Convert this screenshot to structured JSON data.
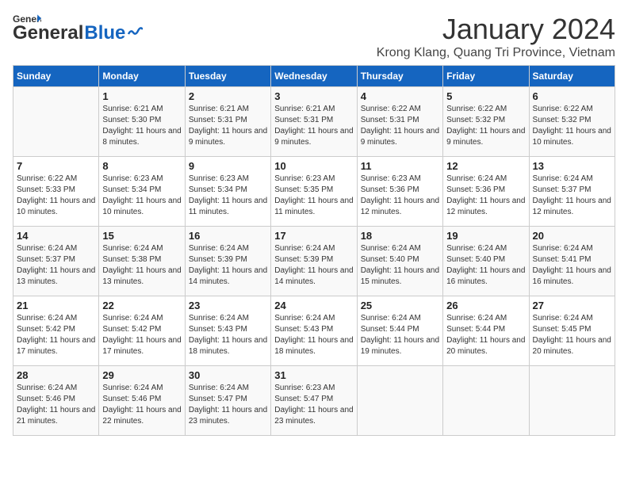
{
  "header": {
    "logo_line1": "General",
    "logo_line2": "Blue",
    "month": "January 2024",
    "location": "Krong Klang, Quang Tri Province, Vietnam"
  },
  "days_of_week": [
    "Sunday",
    "Monday",
    "Tuesday",
    "Wednesday",
    "Thursday",
    "Friday",
    "Saturday"
  ],
  "weeks": [
    [
      {
        "num": "",
        "sunrise": "",
        "sunset": "",
        "daylight": ""
      },
      {
        "num": "1",
        "sunrise": "Sunrise: 6:21 AM",
        "sunset": "Sunset: 5:30 PM",
        "daylight": "Daylight: 11 hours and 8 minutes."
      },
      {
        "num": "2",
        "sunrise": "Sunrise: 6:21 AM",
        "sunset": "Sunset: 5:31 PM",
        "daylight": "Daylight: 11 hours and 9 minutes."
      },
      {
        "num": "3",
        "sunrise": "Sunrise: 6:21 AM",
        "sunset": "Sunset: 5:31 PM",
        "daylight": "Daylight: 11 hours and 9 minutes."
      },
      {
        "num": "4",
        "sunrise": "Sunrise: 6:22 AM",
        "sunset": "Sunset: 5:31 PM",
        "daylight": "Daylight: 11 hours and 9 minutes."
      },
      {
        "num": "5",
        "sunrise": "Sunrise: 6:22 AM",
        "sunset": "Sunset: 5:32 PM",
        "daylight": "Daylight: 11 hours and 9 minutes."
      },
      {
        "num": "6",
        "sunrise": "Sunrise: 6:22 AM",
        "sunset": "Sunset: 5:32 PM",
        "daylight": "Daylight: 11 hours and 10 minutes."
      }
    ],
    [
      {
        "num": "7",
        "sunrise": "Sunrise: 6:22 AM",
        "sunset": "Sunset: 5:33 PM",
        "daylight": "Daylight: 11 hours and 10 minutes."
      },
      {
        "num": "8",
        "sunrise": "Sunrise: 6:23 AM",
        "sunset": "Sunset: 5:34 PM",
        "daylight": "Daylight: 11 hours and 10 minutes."
      },
      {
        "num": "9",
        "sunrise": "Sunrise: 6:23 AM",
        "sunset": "Sunset: 5:34 PM",
        "daylight": "Daylight: 11 hours and 11 minutes."
      },
      {
        "num": "10",
        "sunrise": "Sunrise: 6:23 AM",
        "sunset": "Sunset: 5:35 PM",
        "daylight": "Daylight: 11 hours and 11 minutes."
      },
      {
        "num": "11",
        "sunrise": "Sunrise: 6:23 AM",
        "sunset": "Sunset: 5:36 PM",
        "daylight": "Daylight: 11 hours and 12 minutes."
      },
      {
        "num": "12",
        "sunrise": "Sunrise: 6:24 AM",
        "sunset": "Sunset: 5:36 PM",
        "daylight": "Daylight: 11 hours and 12 minutes."
      },
      {
        "num": "13",
        "sunrise": "Sunrise: 6:24 AM",
        "sunset": "Sunset: 5:37 PM",
        "daylight": "Daylight: 11 hours and 12 minutes."
      }
    ],
    [
      {
        "num": "14",
        "sunrise": "Sunrise: 6:24 AM",
        "sunset": "Sunset: 5:37 PM",
        "daylight": "Daylight: 11 hours and 13 minutes."
      },
      {
        "num": "15",
        "sunrise": "Sunrise: 6:24 AM",
        "sunset": "Sunset: 5:38 PM",
        "daylight": "Daylight: 11 hours and 13 minutes."
      },
      {
        "num": "16",
        "sunrise": "Sunrise: 6:24 AM",
        "sunset": "Sunset: 5:39 PM",
        "daylight": "Daylight: 11 hours and 14 minutes."
      },
      {
        "num": "17",
        "sunrise": "Sunrise: 6:24 AM",
        "sunset": "Sunset: 5:39 PM",
        "daylight": "Daylight: 11 hours and 14 minutes."
      },
      {
        "num": "18",
        "sunrise": "Sunrise: 6:24 AM",
        "sunset": "Sunset: 5:40 PM",
        "daylight": "Daylight: 11 hours and 15 minutes."
      },
      {
        "num": "19",
        "sunrise": "Sunrise: 6:24 AM",
        "sunset": "Sunset: 5:40 PM",
        "daylight": "Daylight: 11 hours and 16 minutes."
      },
      {
        "num": "20",
        "sunrise": "Sunrise: 6:24 AM",
        "sunset": "Sunset: 5:41 PM",
        "daylight": "Daylight: 11 hours and 16 minutes."
      }
    ],
    [
      {
        "num": "21",
        "sunrise": "Sunrise: 6:24 AM",
        "sunset": "Sunset: 5:42 PM",
        "daylight": "Daylight: 11 hours and 17 minutes."
      },
      {
        "num": "22",
        "sunrise": "Sunrise: 6:24 AM",
        "sunset": "Sunset: 5:42 PM",
        "daylight": "Daylight: 11 hours and 17 minutes."
      },
      {
        "num": "23",
        "sunrise": "Sunrise: 6:24 AM",
        "sunset": "Sunset: 5:43 PM",
        "daylight": "Daylight: 11 hours and 18 minutes."
      },
      {
        "num": "24",
        "sunrise": "Sunrise: 6:24 AM",
        "sunset": "Sunset: 5:43 PM",
        "daylight": "Daylight: 11 hours and 18 minutes."
      },
      {
        "num": "25",
        "sunrise": "Sunrise: 6:24 AM",
        "sunset": "Sunset: 5:44 PM",
        "daylight": "Daylight: 11 hours and 19 minutes."
      },
      {
        "num": "26",
        "sunrise": "Sunrise: 6:24 AM",
        "sunset": "Sunset: 5:44 PM",
        "daylight": "Daylight: 11 hours and 20 minutes."
      },
      {
        "num": "27",
        "sunrise": "Sunrise: 6:24 AM",
        "sunset": "Sunset: 5:45 PM",
        "daylight": "Daylight: 11 hours and 20 minutes."
      }
    ],
    [
      {
        "num": "28",
        "sunrise": "Sunrise: 6:24 AM",
        "sunset": "Sunset: 5:46 PM",
        "daylight": "Daylight: 11 hours and 21 minutes."
      },
      {
        "num": "29",
        "sunrise": "Sunrise: 6:24 AM",
        "sunset": "Sunset: 5:46 PM",
        "daylight": "Daylight: 11 hours and 22 minutes."
      },
      {
        "num": "30",
        "sunrise": "Sunrise: 6:24 AM",
        "sunset": "Sunset: 5:47 PM",
        "daylight": "Daylight: 11 hours and 23 minutes."
      },
      {
        "num": "31",
        "sunrise": "Sunrise: 6:23 AM",
        "sunset": "Sunset: 5:47 PM",
        "daylight": "Daylight: 11 hours and 23 minutes."
      },
      {
        "num": "",
        "sunrise": "",
        "sunset": "",
        "daylight": ""
      },
      {
        "num": "",
        "sunrise": "",
        "sunset": "",
        "daylight": ""
      },
      {
        "num": "",
        "sunrise": "",
        "sunset": "",
        "daylight": ""
      }
    ]
  ]
}
